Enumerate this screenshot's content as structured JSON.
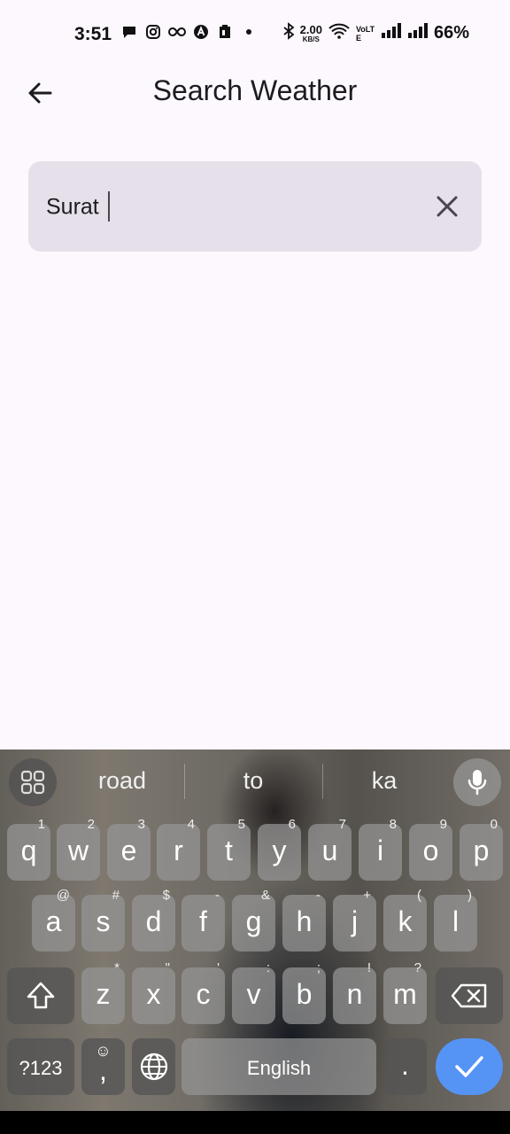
{
  "status_bar": {
    "time": "3:51",
    "net_speed_value": "2.00",
    "net_speed_unit": "KB/S",
    "network_label": "VoLTE",
    "battery": "66%"
  },
  "app_bar": {
    "title": "Search Weather"
  },
  "search": {
    "value": "Surat"
  },
  "keyboard": {
    "suggestions": [
      "road",
      "to",
      "ka"
    ],
    "row1": [
      {
        "key": "q",
        "hint": "1"
      },
      {
        "key": "w",
        "hint": "2"
      },
      {
        "key": "e",
        "hint": "3"
      },
      {
        "key": "r",
        "hint": "4"
      },
      {
        "key": "t",
        "hint": "5"
      },
      {
        "key": "y",
        "hint": "6"
      },
      {
        "key": "u",
        "hint": "7"
      },
      {
        "key": "i",
        "hint": "8"
      },
      {
        "key": "o",
        "hint": "9"
      },
      {
        "key": "p",
        "hint": "0"
      }
    ],
    "row2": [
      {
        "key": "a",
        "hint": "@"
      },
      {
        "key": "s",
        "hint": "#"
      },
      {
        "key": "d",
        "hint": "$"
      },
      {
        "key": "f",
        "hint": "-"
      },
      {
        "key": "g",
        "hint": "&"
      },
      {
        "key": "h",
        "hint": "-"
      },
      {
        "key": "j",
        "hint": "+"
      },
      {
        "key": "k",
        "hint": "("
      },
      {
        "key": "l",
        "hint": ")"
      }
    ],
    "row3": [
      {
        "key": "z",
        "hint": "*"
      },
      {
        "key": "x",
        "hint": "\""
      },
      {
        "key": "c",
        "hint": "'"
      },
      {
        "key": "v",
        "hint": ":"
      },
      {
        "key": "b",
        "hint": ";"
      },
      {
        "key": "n",
        "hint": "!"
      },
      {
        "key": "m",
        "hint": "?"
      }
    ],
    "symbols_key": "?123",
    "comma_key": ",",
    "space_label": "English",
    "period_key": "."
  }
}
